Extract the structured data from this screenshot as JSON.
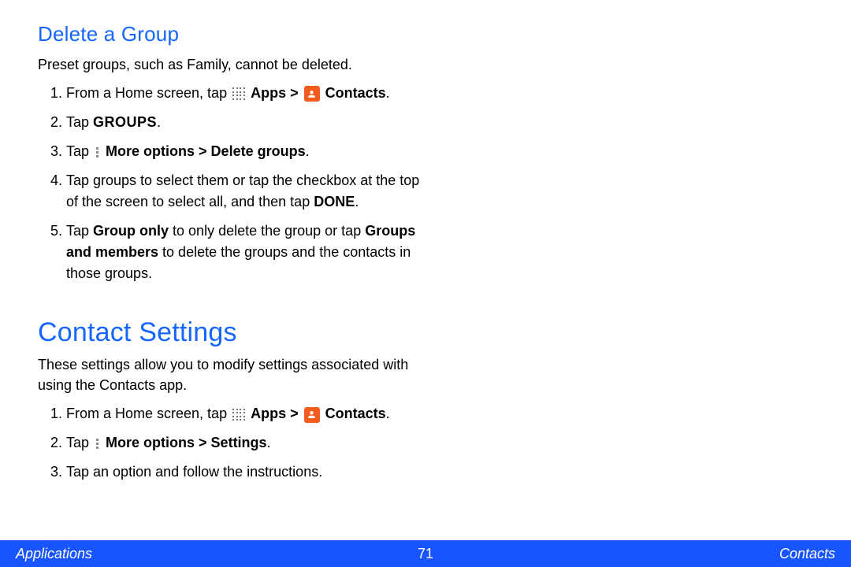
{
  "colors": {
    "heading": "#1565ff",
    "footer_bg": "#1955ff",
    "contacts_tile": "#f35c1c"
  },
  "section1": {
    "title": "Delete a Group",
    "intro": "Preset groups, such as Family, cannot be deleted.",
    "steps": {
      "s1": {
        "pre": "From a Home screen, tap ",
        "apps_label": "Apps > ",
        "contacts_label": " Contacts",
        "tail": "."
      },
      "s2": {
        "pre": "Tap ",
        "bold": "GROUPS",
        "tail": "."
      },
      "s3": {
        "pre": "Tap ",
        "bold": "More options > Delete groups",
        "tail": "."
      },
      "s4": {
        "pre": "Tap groups to select them or tap the checkbox at the top of the screen to select all, and then tap ",
        "bold": "DONE",
        "tail": "."
      },
      "s5": {
        "pre": "Tap ",
        "b1": "Group only",
        "mid": " to only delete the group or tap ",
        "b2": "Groups and members",
        "tail": " to delete the groups and the contacts in those groups."
      }
    }
  },
  "section2": {
    "title": "Contact Settings",
    "intro": "These settings allow you to modify settings associated with using the Contacts app.",
    "steps": {
      "s1": {
        "pre": "From a Home screen, tap ",
        "apps_label": "Apps > ",
        "contacts_label": " Contacts",
        "tail": "."
      },
      "s2": {
        "pre": "Tap ",
        "bold": "More options > Settings",
        "tail": "."
      },
      "s3": {
        "text": "Tap an option and follow the instructions."
      }
    }
  },
  "footer": {
    "left": "Applications",
    "center": "71",
    "right": "Contacts"
  }
}
